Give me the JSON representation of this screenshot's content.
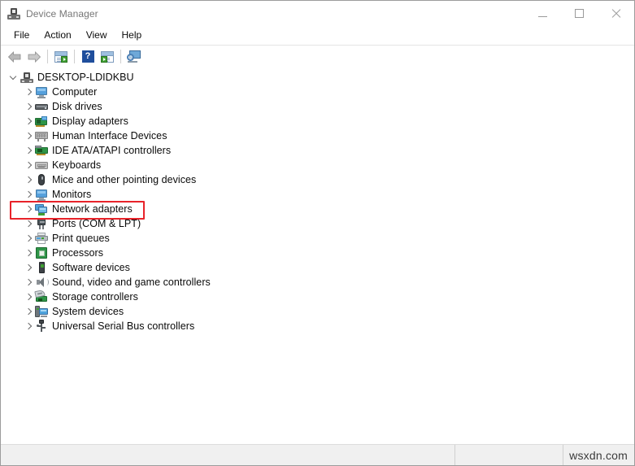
{
  "window": {
    "title": "Device Manager",
    "icon": "device-manager-icon",
    "controls": {
      "minimize": "–",
      "maximize": "□",
      "close": "✕"
    }
  },
  "menu": {
    "items": [
      {
        "label": "File"
      },
      {
        "label": "Action"
      },
      {
        "label": "View"
      },
      {
        "label": "Help"
      }
    ]
  },
  "toolbar": {
    "buttons": [
      {
        "name": "back-button",
        "icon": "back-arrow-icon"
      },
      {
        "name": "forward-button",
        "icon": "forward-arrow-icon"
      },
      {
        "name": "properties-button",
        "icon": "properties-icon"
      },
      {
        "name": "help-button",
        "icon": "help-question-icon",
        "glyph": "?"
      },
      {
        "name": "update-driver-button",
        "icon": "update-driver-icon"
      },
      {
        "name": "scan-hardware-changes-button",
        "icon": "scan-monitor-icon"
      }
    ]
  },
  "tree": {
    "root": {
      "label": "DESKTOP-LDIDKBU",
      "icon": "computer-root-icon",
      "expanded": true
    },
    "nodes": [
      {
        "label": "Computer",
        "icon": "monitor-icon",
        "expanded": false
      },
      {
        "label": "Disk drives",
        "icon": "disk-drive-icon",
        "expanded": false
      },
      {
        "label": "Display adapters",
        "icon": "display-adapter-icon",
        "expanded": false
      },
      {
        "label": "Human Interface Devices",
        "icon": "hid-icon",
        "expanded": false
      },
      {
        "label": "IDE ATA/ATAPI controllers",
        "icon": "ide-controller-icon",
        "expanded": false
      },
      {
        "label": "Keyboards",
        "icon": "keyboard-icon",
        "expanded": false
      },
      {
        "label": "Mice and other pointing devices",
        "icon": "mouse-icon",
        "expanded": false
      },
      {
        "label": "Monitors",
        "icon": "monitor-icon",
        "expanded": false
      },
      {
        "label": "Network adapters",
        "icon": "network-adapter-icon",
        "expanded": false,
        "highlighted": true
      },
      {
        "label": "Ports (COM & LPT)",
        "icon": "port-plug-icon",
        "expanded": false
      },
      {
        "label": "Print queues",
        "icon": "printer-icon",
        "expanded": false
      },
      {
        "label": "Processors",
        "icon": "processor-icon",
        "expanded": false
      },
      {
        "label": "Software devices",
        "icon": "software-device-icon",
        "expanded": false
      },
      {
        "label": "Sound, video and game controllers",
        "icon": "sound-speaker-icon",
        "expanded": false
      },
      {
        "label": "Storage controllers",
        "icon": "storage-controller-icon",
        "expanded": false
      },
      {
        "label": "System devices",
        "icon": "system-device-icon",
        "expanded": false
      },
      {
        "label": "Universal Serial Bus controllers",
        "icon": "usb-icon",
        "expanded": false
      }
    ]
  },
  "annotation": {
    "type": "highlight-rectangle",
    "target_label": "Network adapters",
    "color": "#e8232a"
  },
  "statusbar": {
    "left_text": "",
    "mid_text": "",
    "watermark": "wsxdn.com"
  },
  "colors": {
    "accent_red": "#e8232a",
    "title_text": "#767676",
    "window_border": "#9c9c9c",
    "statusbar_bg": "#f0f0f0"
  }
}
